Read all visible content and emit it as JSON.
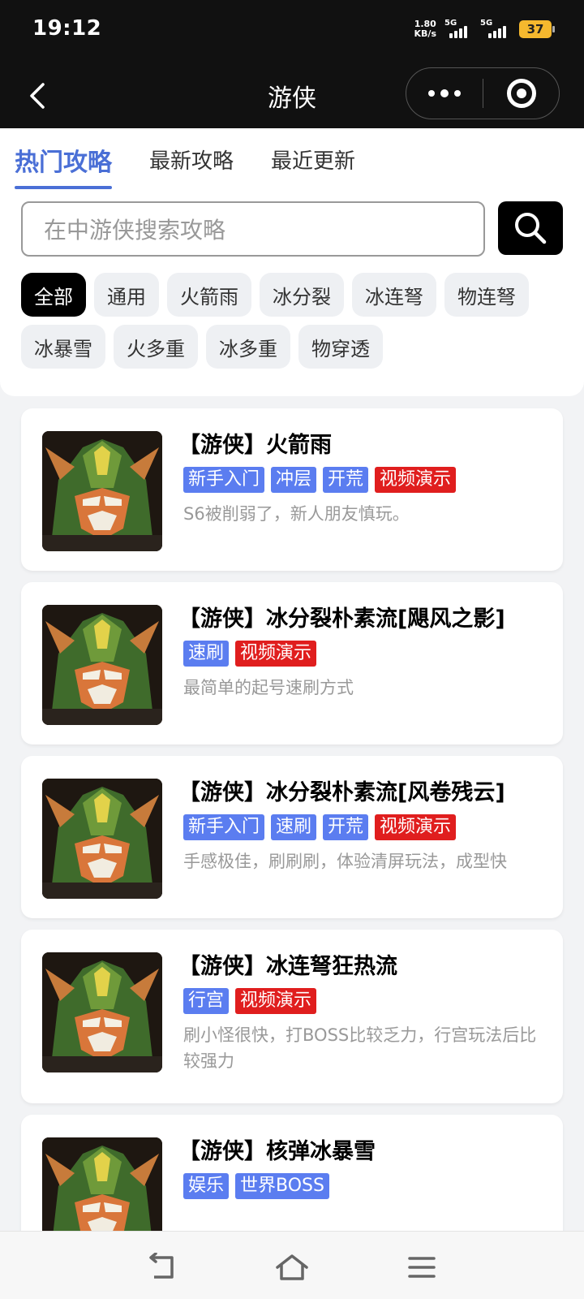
{
  "status_bar": {
    "time": "19:12",
    "net_speed_value": "1.80",
    "net_speed_unit": "KB/s",
    "signal1_label": "5G",
    "signal2_label": "5G",
    "battery": "37"
  },
  "nav": {
    "title": "游侠"
  },
  "tabs": [
    {
      "label": "热门攻略",
      "active": true
    },
    {
      "label": "最新攻略",
      "active": false
    },
    {
      "label": "最近更新",
      "active": false
    }
  ],
  "search": {
    "placeholder": "在中游侠搜索攻略"
  },
  "filters": [
    {
      "label": "全部",
      "active": true
    },
    {
      "label": "通用"
    },
    {
      "label": "火箭雨"
    },
    {
      "label": "冰分裂"
    },
    {
      "label": "冰连弩"
    },
    {
      "label": "物连弩"
    },
    {
      "label": "冰暴雪"
    },
    {
      "label": "火多重"
    },
    {
      "label": "冰多重"
    },
    {
      "label": "物穿透"
    }
  ],
  "guides": [
    {
      "title": "【游侠】火箭雨",
      "tags": [
        {
          "text": "新手入门",
          "color": "#5b7df0"
        },
        {
          "text": "冲层",
          "color": "#5b7df0"
        },
        {
          "text": "开荒",
          "color": "#5b7df0"
        },
        {
          "text": "视频演示",
          "color": "#e01e1e"
        }
      ],
      "desc": "S6被削弱了，新人朋友慎玩。"
    },
    {
      "title": "【游侠】冰分裂朴素流[飓风之影]",
      "tags": [
        {
          "text": "速刷",
          "color": "#5b7df0"
        },
        {
          "text": "视频演示",
          "color": "#e01e1e"
        }
      ],
      "desc": "最简单的起号速刷方式"
    },
    {
      "title": "【游侠】冰分裂朴素流[风卷残云]",
      "tags": [
        {
          "text": "新手入门",
          "color": "#5b7df0"
        },
        {
          "text": "速刷",
          "color": "#5b7df0"
        },
        {
          "text": "开荒",
          "color": "#5b7df0"
        },
        {
          "text": "视频演示",
          "color": "#e01e1e"
        }
      ],
      "desc": "手感极佳，刷刷刷，体验清屏玩法，成型快"
    },
    {
      "title": "【游侠】冰连弩狂热流",
      "tags": [
        {
          "text": "行宫",
          "color": "#5b7df0"
        },
        {
          "text": "视频演示",
          "color": "#e01e1e"
        }
      ],
      "desc": "刷小怪很快，打BOSS比较乏力，行宫玩法后比较强力"
    },
    {
      "title": "【游侠】核弹冰暴雪",
      "tags": [
        {
          "text": "娱乐",
          "color": "#5b7df0"
        },
        {
          "text": "世界BOSS",
          "color": "#5b7df0"
        }
      ],
      "desc": ""
    }
  ]
}
